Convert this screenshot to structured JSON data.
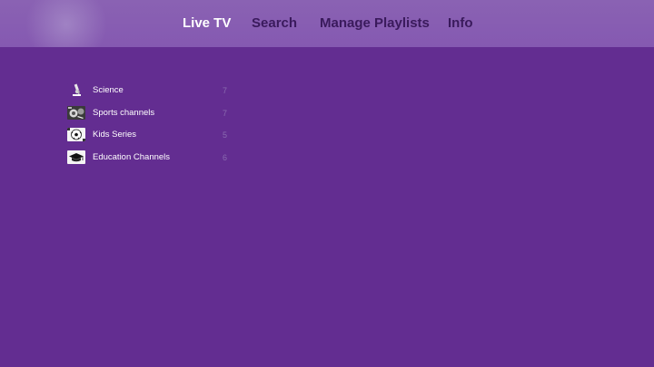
{
  "nav": {
    "tabs": [
      {
        "label": "Live TV",
        "active": true
      },
      {
        "label": "Search",
        "active": false
      },
      {
        "label": "Manage Playlists",
        "active": false
      },
      {
        "label": "Info",
        "active": false
      }
    ]
  },
  "playlists": [
    {
      "label": "Science",
      "count": "7",
      "icon": "microscope-icon"
    },
    {
      "label": "Sports channels",
      "count": "7",
      "icon": "sports-icon"
    },
    {
      "label": "Kids Series",
      "count": "5",
      "icon": "soccer-ball-icon"
    },
    {
      "label": "Education Channels",
      "count": "6",
      "icon": "graduation-cap-icon"
    }
  ],
  "colors": {
    "background": "#632d91",
    "topbar": "#8559b1",
    "active_tab": "#ffffff",
    "inactive_tab": "#3a1a5c",
    "count_text": "#8a6bb0"
  }
}
